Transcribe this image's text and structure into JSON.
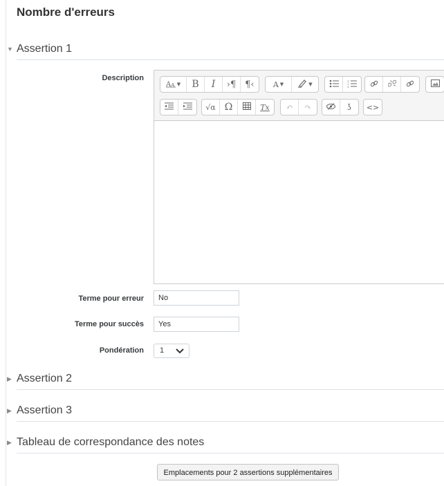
{
  "page": {
    "title": "Nombre d'erreurs"
  },
  "sections": [
    {
      "title": "Assertion 1",
      "expanded": true
    },
    {
      "title": "Assertion 2",
      "expanded": false
    },
    {
      "title": "Assertion 3",
      "expanded": false
    },
    {
      "title": "Tableau de correspondance des notes",
      "expanded": false
    }
  ],
  "form": {
    "description_label": "Description",
    "description_value": "",
    "error_term_label": "Terme pour erreur",
    "error_term_value": "No",
    "success_term_label": "Terme pour succès",
    "success_term_value": "Yes",
    "weight_label": "Pondération",
    "weight_value": "1"
  },
  "toolbar": {
    "bold": "B",
    "italic": "I",
    "font_color": "A",
    "omega": "Ω",
    "clear_format": "Tx"
  },
  "buttons": {
    "add_assertions": "Emplacements pour 2 assertions supplémentaires"
  }
}
